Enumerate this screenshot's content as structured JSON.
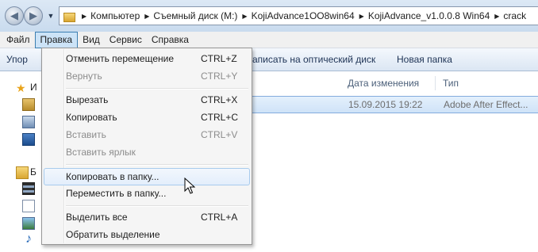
{
  "address_bar": {
    "breadcrumbs": [
      "Компьютер",
      "Съемный диск (M:)",
      "KojiAdvance1OO8win64",
      "KojiAdvance_v1.0.0.8 Win64",
      "crack"
    ]
  },
  "menu_bar": {
    "items": [
      "Файл",
      "Правка",
      "Вид",
      "Сервис",
      "Справка"
    ],
    "active": "Правка"
  },
  "toolbar": {
    "organize_label": "Упор",
    "burn_label": "аписать на оптический диск",
    "new_folder_label": "Новая папка"
  },
  "nav_pane": {
    "favorites_label": "И",
    "libraries_label": "Б"
  },
  "file_list": {
    "columns": {
      "date_modified": "Дата изменения",
      "type": "Тип"
    },
    "rows": [
      {
        "date": "15.09.2015 19:22",
        "type": "Adobe After Effect..."
      }
    ]
  },
  "edit_menu": {
    "items": [
      {
        "label": "Отменить перемещение",
        "shortcut": "CTRL+Z",
        "enabled": true
      },
      {
        "label": "Вернуть",
        "shortcut": "CTRL+Y",
        "enabled": false
      },
      {
        "label": "Вырезать",
        "shortcut": "CTRL+X",
        "enabled": true
      },
      {
        "label": "Копировать",
        "shortcut": "CTRL+C",
        "enabled": true
      },
      {
        "label": "Вставить",
        "shortcut": "CTRL+V",
        "enabled": false
      },
      {
        "label": "Вставить ярлык",
        "shortcut": "",
        "enabled": false
      },
      {
        "label": "Копировать в папку...",
        "shortcut": "",
        "enabled": true
      },
      {
        "label": "Переместить в папку...",
        "shortcut": "",
        "enabled": true
      },
      {
        "label": "Выделить все",
        "shortcut": "CTRL+A",
        "enabled": true
      },
      {
        "label": "Обратить выделение",
        "shortcut": "",
        "enabled": true
      }
    ],
    "highlighted": "Копировать в папку..."
  },
  "colors": {
    "menu_highlight": "#cce3f7",
    "selection_border": "#84acdd",
    "disabled_text": "#8c8c8c"
  }
}
